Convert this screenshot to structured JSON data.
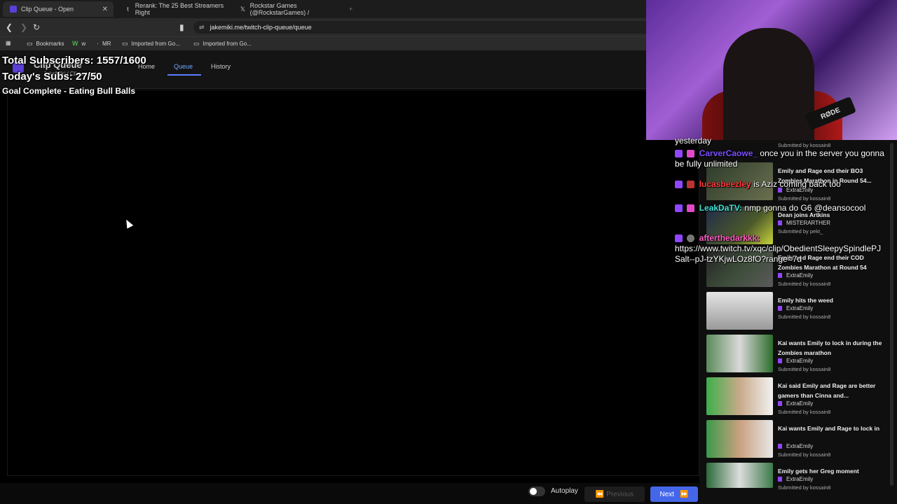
{
  "tabs": [
    {
      "label": "Clip Queue - Open",
      "active": true
    },
    {
      "label": "Rerank: The 25 Best Streamers Right"
    },
    {
      "label": "Rockstar Games (@RockstarGames) /"
    }
  ],
  "url": "jakemiki.me/twitch-clip-queue/queue",
  "bookmarks": [
    {
      "label": "Bookmarks"
    },
    {
      "label": "w"
    },
    {
      "label": "MR"
    },
    {
      "label": "Imported from Go..."
    },
    {
      "label": "Imported from Go..."
    }
  ],
  "app": {
    "title": "Clip Queue",
    "subtitle": "JakeMiki / Clip queue",
    "nav": [
      "Home",
      "Queue",
      "History"
    ]
  },
  "overlay": {
    "subs": "Total Subscribers: 1557/1600",
    "today": "Today's Subs: 27/50",
    "goal": "Goal Complete - Eating Bull Balls"
  },
  "controls": {
    "autoplay": "Autoplay",
    "previous": "Previous",
    "next": "Next"
  },
  "webcam": {
    "mic_label": "RØDE"
  },
  "chat": [
    {
      "user": "",
      "text": "yesterday"
    },
    {
      "user": "CarverCaowe_",
      "text": "once you in the server you gonna be fully unlimited"
    },
    {
      "user": "lucasbeezley",
      "text": "is Aziz coming back too"
    },
    {
      "user": "LeakDaTV:",
      "text": "nmp gonna do G6 @deansocool"
    },
    {
      "user": "afterthedarkkk:",
      "text": "https://www.twitch.tv/xqc/clip/ObedientSleepySpindlePJSalt--pJ-tzYKjwLOz8fO?range=7d"
    }
  ],
  "queue": [
    {
      "title": "",
      "channel": "",
      "submitter": "Submitted by kossain8"
    },
    {
      "title": "Emily and Rage end their BO3 Zombies Marathon in Round 54...",
      "channel": "ExtraEmily",
      "submitter": "Submitted by kossain8"
    },
    {
      "title": "Dean joins Artkins",
      "channel": "MISTERARTHER",
      "submitter": "Submitted by pekt_"
    },
    {
      "title": "Emily and Rage end their COD Zombies Marathon at Round 54",
      "channel": "ExtraEmily",
      "submitter": "Submitted by kossain8"
    },
    {
      "title": "Emily hits the weed",
      "channel": "ExtraEmily",
      "submitter": "Submitted by kossain8"
    },
    {
      "title": "Kai wants Emily to lock in during the Zombies marathon",
      "channel": "ExtraEmily",
      "submitter": "Submitted by kossain8"
    },
    {
      "title": "Kai said Emily and Rage are better gamers than Cinna and...",
      "channel": "ExtraEmily",
      "submitter": "Submitted by kossain8"
    },
    {
      "title": "Kai wants Emily and Rage to lock in",
      "channel": "ExtraEmily",
      "submitter": "Submitted by kossain8"
    },
    {
      "title": "Emily gets her Greg moment",
      "channel": "ExtraEmily",
      "submitter": "Submitted by kossain8"
    }
  ],
  "colors": {
    "accent": "#4466e8",
    "twitch": "#9146ff",
    "active_link": "#6ea8ff"
  }
}
